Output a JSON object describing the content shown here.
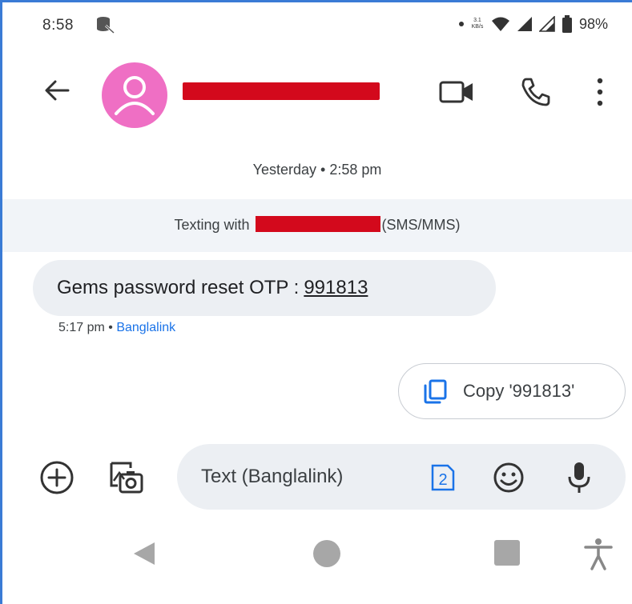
{
  "status_bar": {
    "time": "8:58",
    "net_speed_value": "3.1",
    "net_speed_unit": "KB/s",
    "battery": "98%"
  },
  "conversation": {
    "contact_name_redacted": true,
    "date_header": "Yesterday • 2:58 pm",
    "texting_prefix": "Texting with",
    "texting_suffix": "(SMS/MMS)",
    "message": {
      "text": "Gems password reset OTP :",
      "otp": "991813",
      "time": "5:17 pm",
      "separator": " • ",
      "carrier": "Banglalink"
    },
    "suggestion": {
      "label": "Copy '991813'"
    }
  },
  "compose": {
    "placeholder": "Text (Banglalink)",
    "sim_number": "2"
  },
  "colors": {
    "avatar": "#ef6fc4",
    "redaction": "#d3091c",
    "accent": "#1a73e8",
    "bubble": "#eceff3"
  }
}
